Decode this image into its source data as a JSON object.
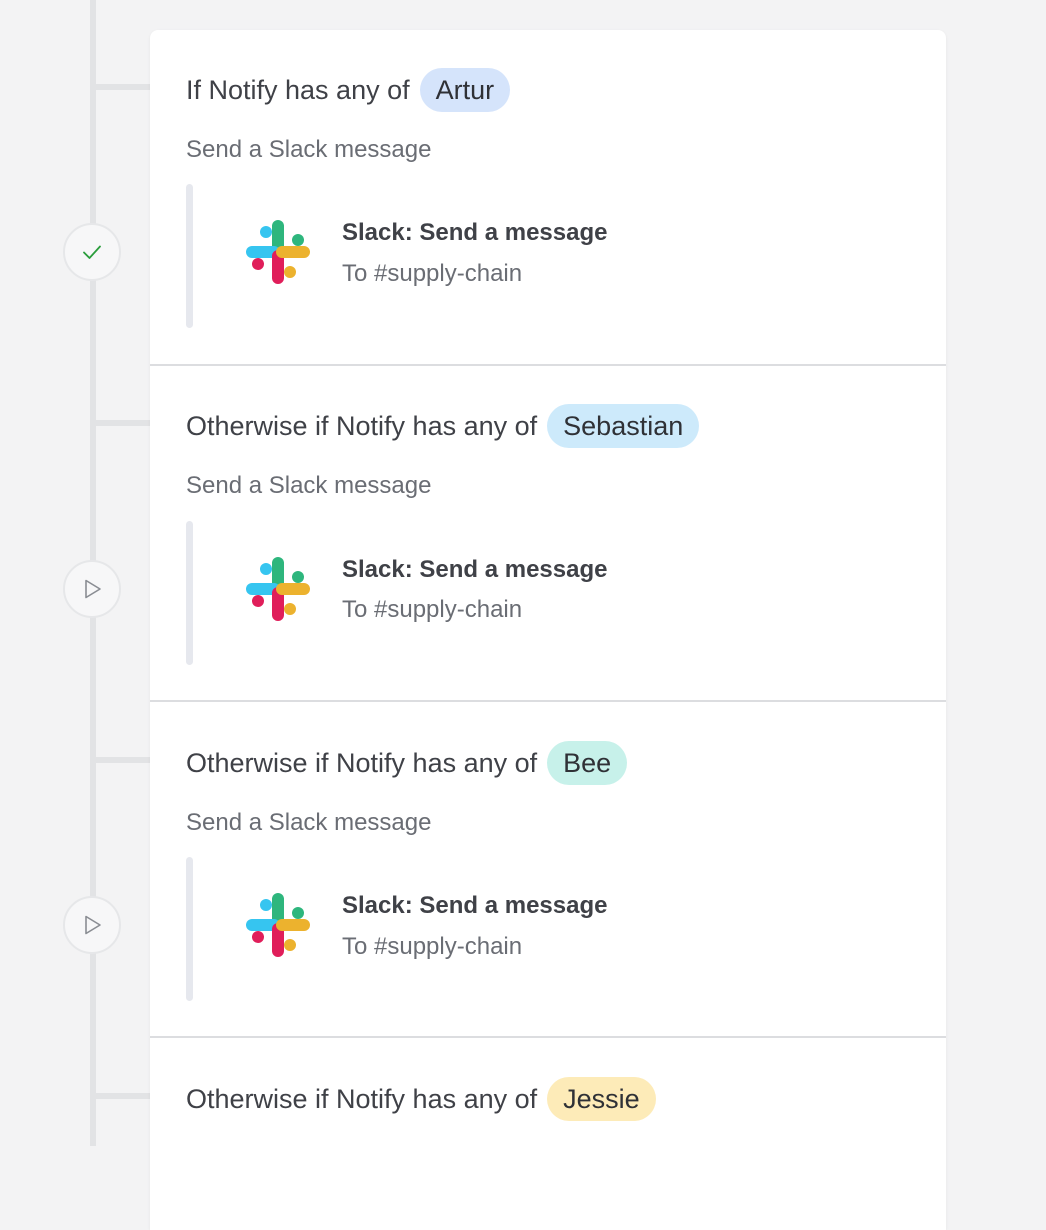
{
  "branches": [
    {
      "condition_label": "If Notify has any of",
      "tag": "Artur",
      "tag_color": "#d5e4fb",
      "subtitle": "Send a Slack message",
      "action_title": "Slack: Send a message",
      "action_detail": "To #supply-chain",
      "status_icon": "check-icon"
    },
    {
      "condition_label": "Otherwise if Notify has any of",
      "tag": "Sebastian",
      "tag_color": "#cdeafb",
      "subtitle": "Send a Slack message",
      "action_title": "Slack: Send a message",
      "action_detail": "To #supply-chain",
      "status_icon": "play-icon"
    },
    {
      "condition_label": "Otherwise if Notify has any of",
      "tag": "Bee",
      "tag_color": "#c7f1ea",
      "subtitle": "Send a Slack message",
      "action_title": "Slack: Send a message",
      "action_detail": "To #supply-chain",
      "status_icon": "play-icon"
    },
    {
      "condition_label": "Otherwise if Notify has any of",
      "tag": "Jessie",
      "tag_color": "#fdebb8"
    }
  ],
  "colors": {
    "check": "#2a9d3c",
    "play_outline": "#8a8d93",
    "slack_blue": "#36c5f0",
    "slack_green": "#2eb67d",
    "slack_red": "#e01e5a",
    "slack_yellow": "#ecb22e"
  }
}
